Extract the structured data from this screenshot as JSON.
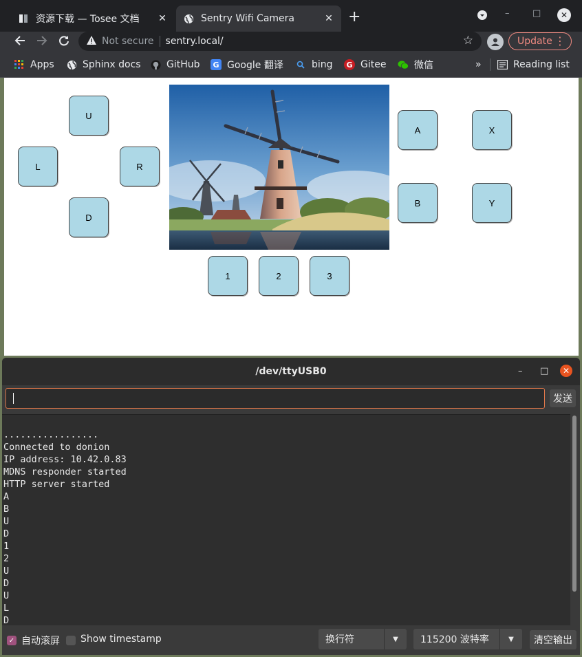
{
  "browser": {
    "tabs": [
      {
        "label": "资源下载 — Tosee 文档",
        "close": "✕"
      },
      {
        "label": "Sentry Wifi Camera",
        "close": "✕"
      }
    ],
    "new_tab": "+",
    "url_warning": "Not secure",
    "url": "sentry.local/",
    "update_label": "Update",
    "bookmarks": [
      "Apps",
      "Sphinx docs",
      "GitHub",
      "Google 翻译",
      "bing",
      "Gitee",
      "微信"
    ],
    "more_bookmarks": "»",
    "reading_list": "Reading list"
  },
  "page": {
    "dpad": {
      "up": "U",
      "left": "L",
      "right": "R",
      "down": "D"
    },
    "face": {
      "a": "A",
      "x": "X",
      "b": "B",
      "y": "Y"
    },
    "numbers": [
      "1",
      "2",
      "3"
    ]
  },
  "serial": {
    "title": "/dev/ttyUSB0",
    "send_label": "发送",
    "output_lines": [
      ".................",
      "Connected to donion",
      "IP address: 10.42.0.83",
      "MDNS responder started",
      "HTTP server started",
      "A",
      "B",
      "U",
      "D",
      "1",
      "2",
      "U",
      "D",
      "U",
      "L",
      "D"
    ],
    "autoscroll_label": "自动滚屏",
    "timestamp_label": "Show timestamp",
    "line_ending": "换行符",
    "baud": "115200 波特率",
    "clear_label": "清空输出"
  }
}
